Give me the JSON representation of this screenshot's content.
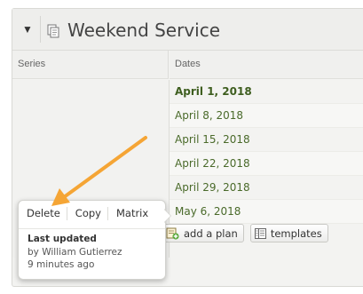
{
  "header": {
    "toggle_icon": "triangle-down-icon",
    "doc_icon": "document-icon",
    "title": "Weekend Service"
  },
  "columns": {
    "series": "Series",
    "dates": "Dates"
  },
  "dates": [
    "April 1, 2018",
    "April 8, 2018",
    "April 15, 2018",
    "April 22, 2018",
    "April 29, 2018",
    "May 6, 2018"
  ],
  "actions": {
    "add_plan_label": "add a plan",
    "add_plan_icon": "add-plan-icon",
    "templates_label": "templates",
    "templates_icon": "templates-icon"
  },
  "popover": {
    "delete_label": "Delete",
    "copy_label": "Copy",
    "matrix_label": "Matrix",
    "last_updated_title": "Last updated",
    "updated_by": "by William Gutierrez",
    "updated_ago": "9 minutes ago"
  },
  "colors": {
    "date_text": "#4a6a2a",
    "annotation_arrow": "#f5a535"
  }
}
